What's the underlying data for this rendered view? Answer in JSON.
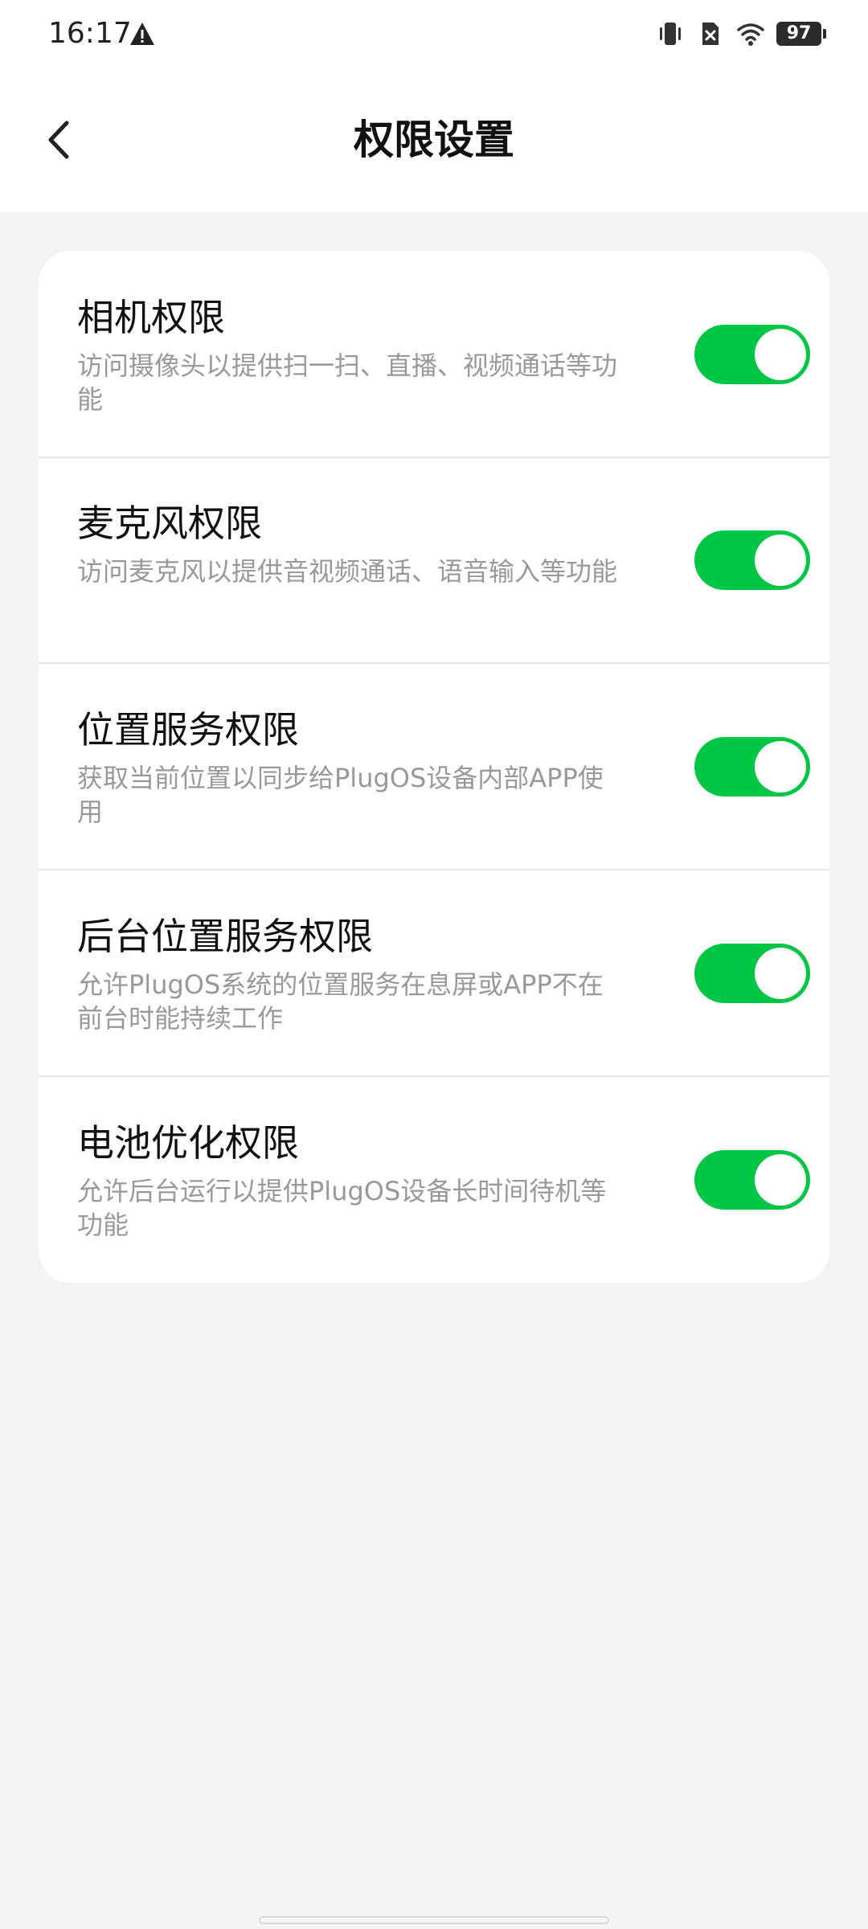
{
  "status_bar": {
    "time": "16:17",
    "battery": "97",
    "icons": [
      "warning-icon",
      "vibrate-icon",
      "no-sim-icon",
      "wifi-icon",
      "battery-icon"
    ]
  },
  "header": {
    "title": "权限设置",
    "back_icon": "chevron-left-icon"
  },
  "permissions": [
    {
      "title": "相机权限",
      "desc": "访问摄像头以提供扫一扫、直播、视频通话等功能",
      "enabled": true
    },
    {
      "title": "麦克风权限",
      "desc": "访问麦克风以提供音视频通话、语音输入等功能",
      "enabled": true
    },
    {
      "title": "位置服务权限",
      "desc": "获取当前位置以同步给PlugOS设备内部APP使用",
      "enabled": true
    },
    {
      "title": "后台位置服务权限",
      "desc": "允许PlugOS系统的位置服务在息屏或APP不在前台时能持续工作",
      "enabled": true
    },
    {
      "title": "电池优化权限",
      "desc": "允许后台运行以提供PlugOS设备长时间待机等功能",
      "enabled": true
    }
  ],
  "colors": {
    "toggle_on": "#00c645",
    "background": "#f3f4f6",
    "card": "#ffffff"
  }
}
